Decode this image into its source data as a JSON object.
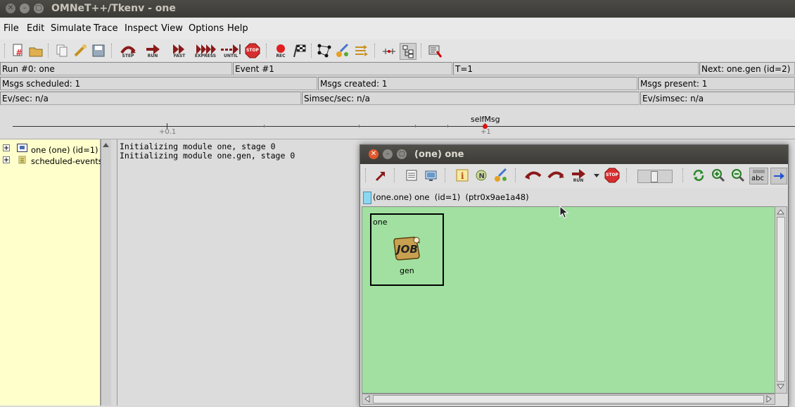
{
  "window": {
    "title": "OMNeT++/Tkenv - one"
  },
  "menu": {
    "items": [
      "File",
      "Edit",
      "Simulate",
      "Trace",
      "Inspect",
      "View",
      "Options",
      "Help"
    ]
  },
  "toolbar": {
    "step_label": "STEP",
    "run_label": "RUN",
    "fast_label": "FAST",
    "express_label": "EXPRESS",
    "until_label": "UNTIL",
    "stop_label": "STOP",
    "rec_label": "REC"
  },
  "status": {
    "run": "Run #0: one",
    "event": "Event #1",
    "time": "T=1",
    "next": "Next: one.gen (id=2)",
    "msgs_scheduled": "Msgs scheduled: 1",
    "msgs_created": "Msgs created: 1",
    "msgs_present": "Msgs present: 1",
    "ev_sec": "Ev/sec: n/a",
    "simsec_sec": "Simsec/sec: n/a",
    "ev_simsec": "Ev/simsec: n/a"
  },
  "timeline": {
    "message_label": "selfMsg",
    "tick_left": "+0.1",
    "tick_right": "+1"
  },
  "tree": {
    "items": [
      {
        "label": "one (one) (id=1)"
      },
      {
        "label": "scheduled-events"
      }
    ]
  },
  "log": {
    "lines": [
      "Initializing module one, stage 0",
      "Initializing module one.gen, stage 0"
    ]
  },
  "inspector": {
    "title": "(one) one",
    "info": "(one.one) one  (id=1)  (ptr0x9ae1a48)",
    "run_label": "RUN",
    "stop_label": "STOP",
    "abc_label": "abc",
    "module_name": "one",
    "submodule_name": "gen",
    "submodule_icon_text": "JOB"
  },
  "colors": {
    "canvas": "#a1e0a1",
    "tree_bg": "#ffffcc",
    "stop": "#d62f2f"
  }
}
